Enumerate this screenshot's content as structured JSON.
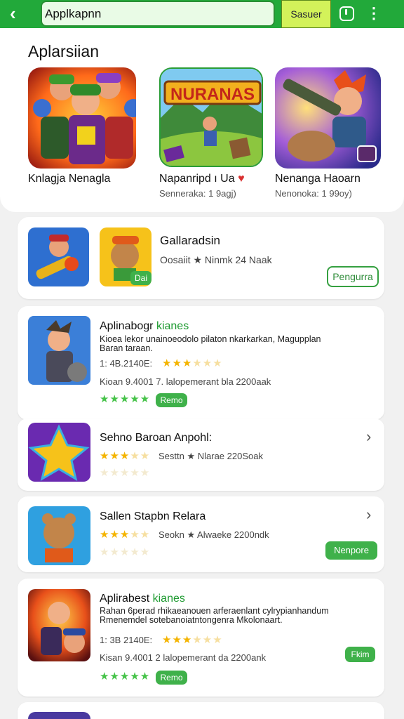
{
  "topbar": {
    "search_value": "Applkapnn",
    "search_button": "Sasuer",
    "back_icon": "back-arrow-icon",
    "history_icon": "clock-icon",
    "menu_icon": "more-vertical-icon",
    "bar_color": "#22a93a"
  },
  "featured": {
    "title": "Aplarsiian",
    "items": [
      {
        "name": "Knlagja Nenagla",
        "sub": "",
        "art_text": ""
      },
      {
        "name": "Napanripd ı Ua",
        "sub": "Senneraka: 1 9agj)",
        "art_text": "NURANAS"
      },
      {
        "name": "Nenanga Haoarn",
        "sub": "Nenonoka: 1 99oy)",
        "art_text": ""
      }
    ]
  },
  "banner": {
    "title": "Gallaradsin",
    "meta": "Oosaiit ★ Ninmk 24 Naak",
    "button": "Pengurra",
    "badge": "Dai"
  },
  "list": [
    {
      "title": "Aplinabogr",
      "title_hl": "kianes",
      "desc": "Kioea lekor unainoeodolo pilaton nkarkarkan, Magupplan Baran taraan.",
      "date": "1: 4B.2140E:",
      "meta": "Kioan 9.4001 7. lalopemerant bla 2200aak",
      "pill": "Remo"
    },
    {
      "title": "Sehno Baroan Anpohl:",
      "meta": "Sesttn ★ Nlarae 220Soak"
    },
    {
      "title": "Sallen Stapbn Relara",
      "meta": "Seokn ★ Alwaeke 2200ndk",
      "button": "Nenpore"
    },
    {
      "title": "Aplirabest",
      "title_hl": "kianes",
      "desc": "Rahan 6perad rhikaeanouen arferaenlant cylrypianhandum Rmenemdel sotebanoiatntongenra Mkolonaart.",
      "date": "1: 3B 2140E:",
      "meta": "Kisan 9.4001 2 lalopemerant da 2200ank",
      "pill": "Remo",
      "pill_right": "Fkim"
    }
  ]
}
